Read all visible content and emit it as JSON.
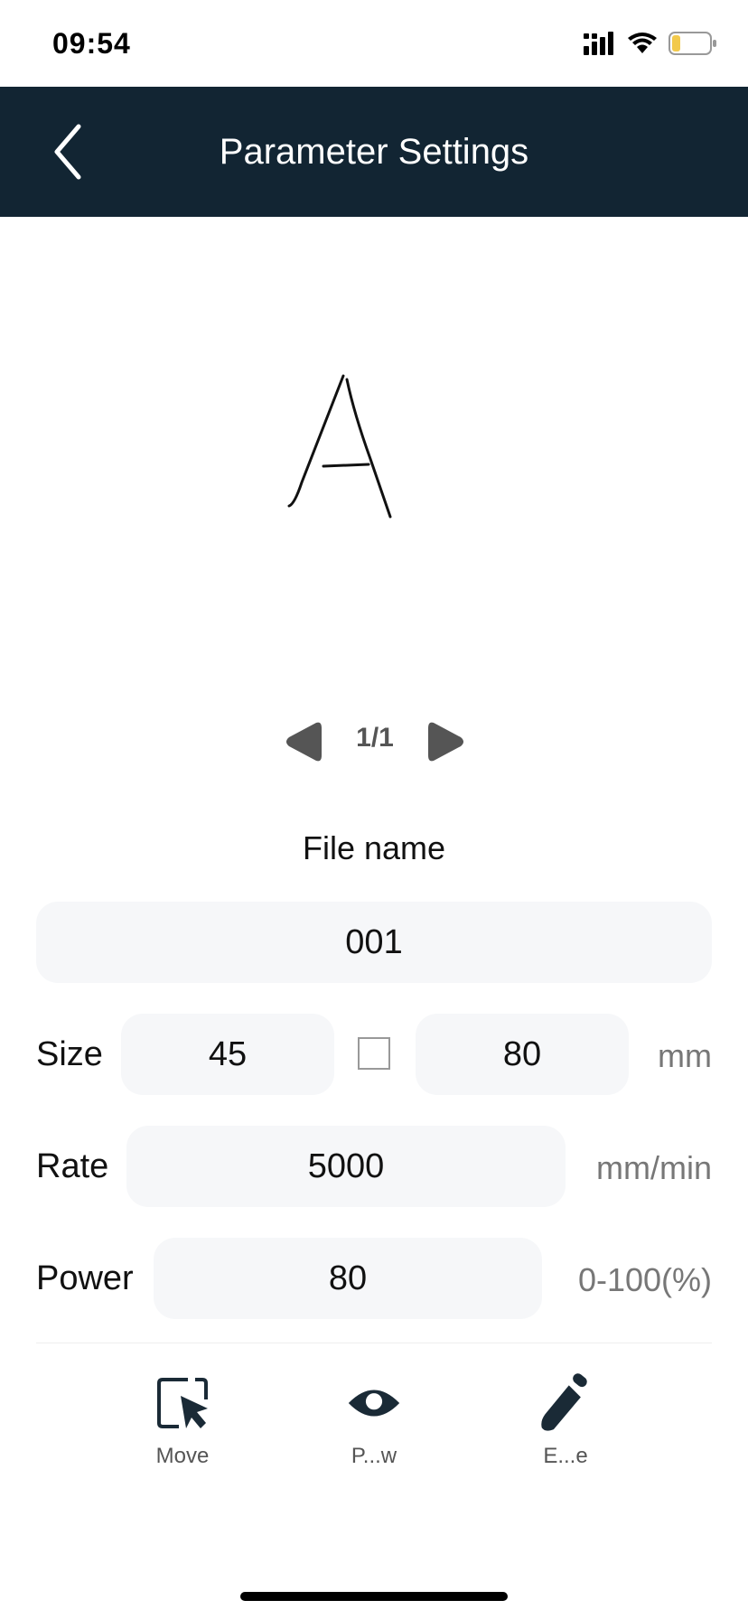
{
  "status_bar": {
    "time": "09:54"
  },
  "header": {
    "title": "Parameter Settings"
  },
  "pager": {
    "label": "1/1"
  },
  "form": {
    "file_name_label": "File name",
    "file_name_value": "001",
    "size_label": "Size",
    "size_width": "45",
    "size_height": "80",
    "size_unit": "mm",
    "rate_label": "Rate",
    "rate_value": "5000",
    "rate_unit": "mm/min",
    "power_label": "Power",
    "power_value": "80",
    "power_unit": "0-100(%)"
  },
  "actions": [
    {
      "label": "Move",
      "icon": "cursor-select-icon"
    },
    {
      "label": "P...w",
      "icon": "eye-icon"
    },
    {
      "label": "E...e",
      "icon": "knife-icon"
    }
  ],
  "colors": {
    "header_bg": "#122533",
    "field_bg": "#f6f7f9",
    "icon_dark": "#1a2a36"
  }
}
